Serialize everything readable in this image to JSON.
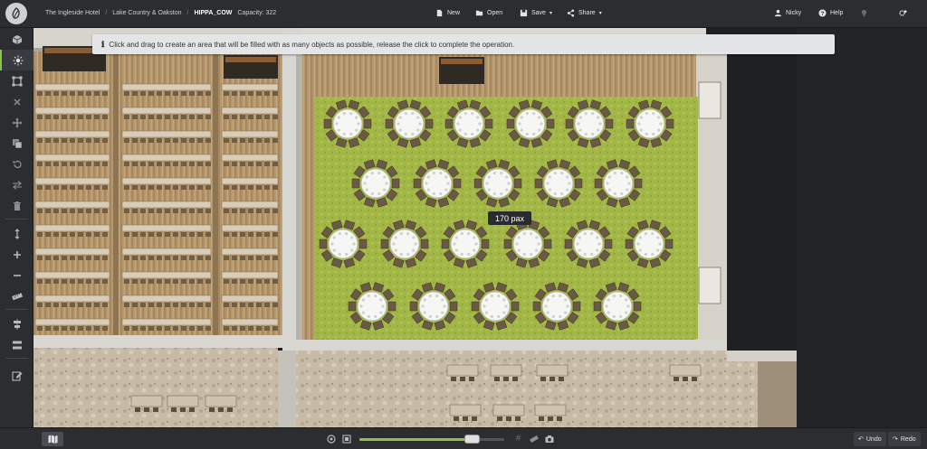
{
  "header": {
    "breadcrumbs": [
      "The Ingleside Hotel",
      "Lake Country & Oakston",
      "HIPPA_COW"
    ],
    "capacity_label": "Capacity: 322",
    "toolbar": {
      "new_label": "New",
      "open_label": "Open",
      "save_label": "Save",
      "share_label": "Share"
    },
    "user_name": "Nicky",
    "help_label": "Help"
  },
  "banner": {
    "message": "Click and drag to create an area that will be filled with as many objects as possible, release the click to complete the operation."
  },
  "pax_label": "170 pax",
  "left_tools": [
    {
      "name": "3d-cube-icon",
      "active": false
    },
    {
      "name": "auto-fill-icon",
      "active": true
    },
    {
      "name": "select-area-icon",
      "active": false
    },
    {
      "name": "delete-icon",
      "active": false
    },
    {
      "name": "move-icon",
      "active": false
    },
    {
      "name": "copy-icon",
      "active": false
    },
    {
      "name": "rotate-icon",
      "active": false
    },
    {
      "name": "swap-icon",
      "active": false
    },
    {
      "name": "trash-icon",
      "active": false
    },
    {
      "name": "height-icon",
      "active": false
    },
    {
      "name": "plus-icon",
      "active": false
    },
    {
      "name": "minus-icon",
      "active": false
    },
    {
      "name": "ruler-icon",
      "active": false
    },
    {
      "name": "align-icon",
      "active": false
    },
    {
      "name": "distribute-icon",
      "active": false
    },
    {
      "name": "edit-icon",
      "active": false
    }
  ],
  "zoom": {
    "level": 0.78
  },
  "bottom": {
    "undo_label": "Undo",
    "redo_label": "Redo"
  },
  "colors": {
    "accent": "#8bc34a",
    "carpet": "#a4b94a",
    "wood_floor": "#b89a72",
    "topbar": "#2c2d31"
  }
}
